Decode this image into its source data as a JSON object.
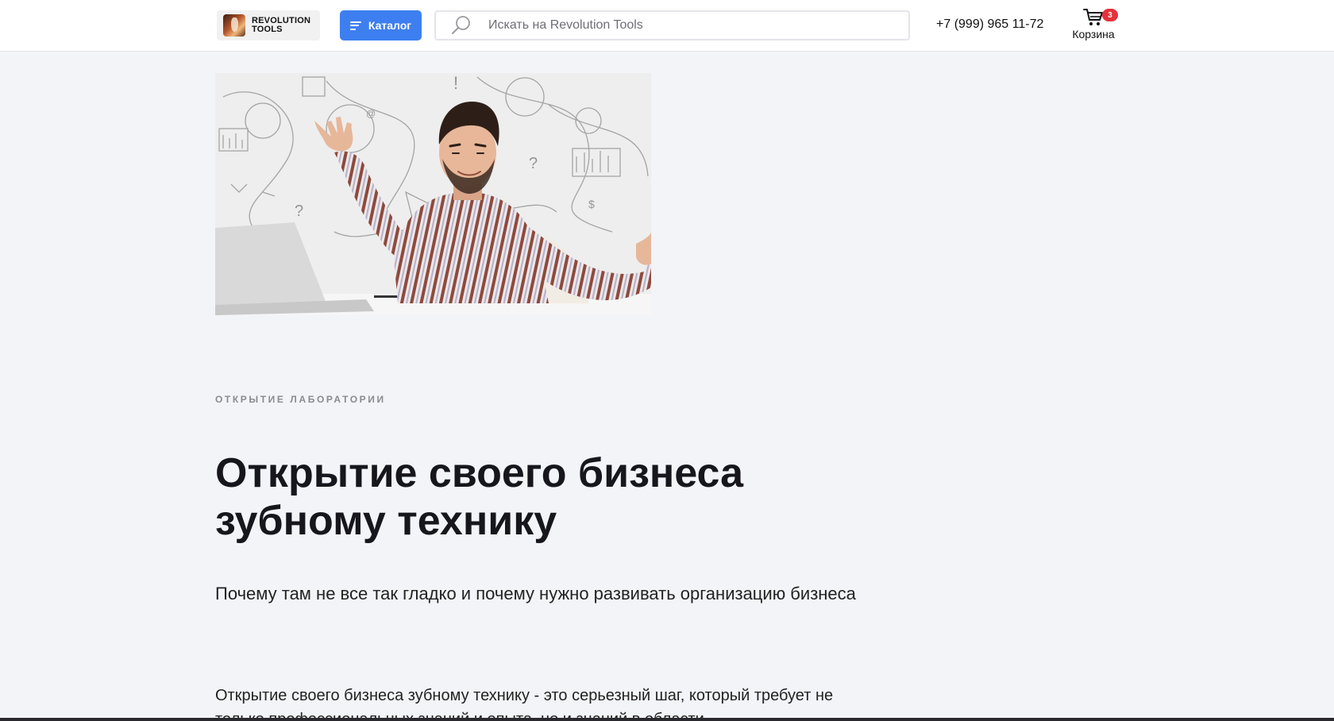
{
  "header": {
    "logo": {
      "line1": "REVOLUTION",
      "line2": "TOOLS"
    },
    "catalog_label": "Каталог",
    "search": {
      "placeholder": "Искать на Revolution Tools",
      "value": ""
    },
    "phone": "+7 (999) 965 11-72",
    "cart": {
      "label": "Корзина",
      "count": "3"
    }
  },
  "article": {
    "eyebrow": "ОТКРЫТИЕ ЛАБОРАТОРИИ",
    "title": "Открытие своего бизнеса зубному технику",
    "subtitle": "Почему там не все так гладко и почему нужно развивать организацию бизнеса",
    "body_start": "Открытие своего бизнеса зубному технику - это серьезный шаг, который требует не только профессиональных знаний и опыта, но и знаний в области"
  },
  "colors": {
    "accent": "#3d7ff0",
    "badge": "#e5313c",
    "background": "#f3f4f7"
  },
  "icons": [
    "logo-icon",
    "menu-icon",
    "search-icon",
    "cart-icon"
  ]
}
